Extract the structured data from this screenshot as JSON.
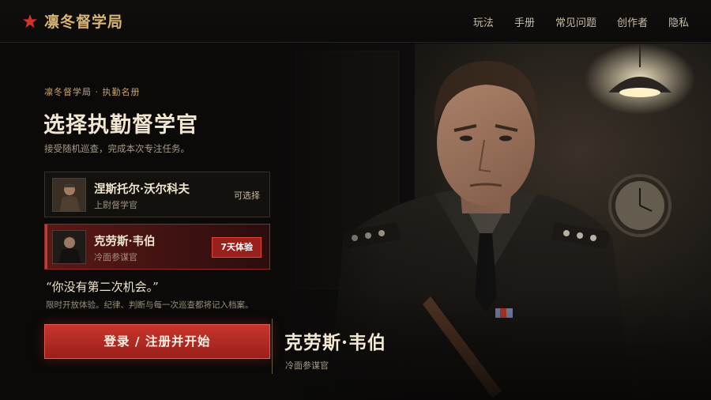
{
  "header": {
    "brand": "凛冬督学局",
    "brand_icon": "red-star-icon",
    "nav": [
      "玩法",
      "手册",
      "常见问题",
      "创作者",
      "隐私"
    ]
  },
  "panel": {
    "kicker": "凛冬督学局 · 执勤名册",
    "title": "选择执勤督学官",
    "subtitle": "接受随机巡查，完成本次专注任务。"
  },
  "officers": [
    {
      "name": "涅斯托尔·沃尔科夫",
      "role": "上尉督学官",
      "status": "可选择"
    },
    {
      "name": "克劳斯·韦伯",
      "role": "冷面参谋官",
      "badge": "7天体验"
    }
  ],
  "quote": "“你没有第二次机会。”",
  "note": "限时开放体验。纪律、判断与每一次巡查都将记入档案。",
  "cta": "登录 / 注册并开始",
  "selected": {
    "name": "克劳斯·韦伯",
    "role": "冷面参谋官"
  },
  "colors": {
    "accent": "#c8352c",
    "gold": "#d9b574",
    "background": "#0b0a09"
  }
}
